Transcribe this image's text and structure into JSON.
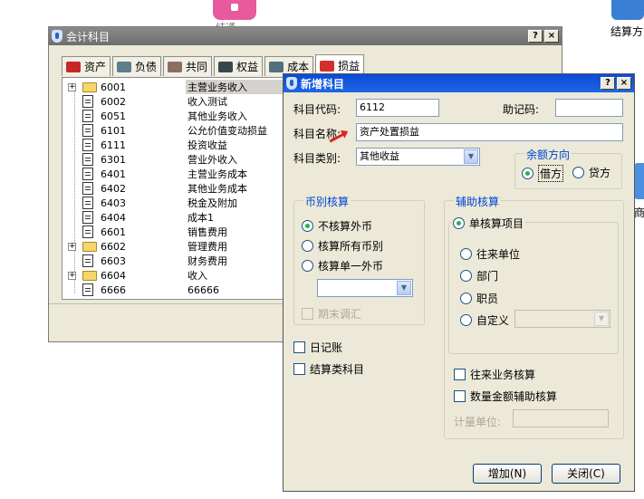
{
  "desktop": {
    "top_icon_label": "结通",
    "right_icon_label": "结算方式",
    "right_icon2_label": "商"
  },
  "accounts_window": {
    "title": "会计科目",
    "buttons": {
      "help": "?",
      "close": "×"
    },
    "tabs": [
      {
        "label": "资产",
        "icon": "car-icon",
        "color": "#c62828"
      },
      {
        "label": "负债",
        "icon": "card-icon",
        "color": "#607d8b"
      },
      {
        "label": "共同",
        "icon": "handshake-icon",
        "color": "#8d6e63"
      },
      {
        "label": "权益",
        "icon": "certificate-icon",
        "color": "#37474f"
      },
      {
        "label": "成本",
        "icon": "tools-icon",
        "color": "#546e7a"
      },
      {
        "label": "损益",
        "icon": "apple-icon",
        "color": "#d32f2f"
      }
    ],
    "active_tab": 5,
    "rows": [
      {
        "code": "6001",
        "name": "主营业务收入",
        "type": "folder",
        "expand": "+",
        "selected": true
      },
      {
        "code": "6002",
        "name": "收入测试",
        "type": "doc"
      },
      {
        "code": "6051",
        "name": "其他业务收入",
        "type": "doc"
      },
      {
        "code": "6101",
        "name": "公允价值变动损益",
        "type": "doc"
      },
      {
        "code": "6111",
        "name": "投资收益",
        "type": "doc"
      },
      {
        "code": "6301",
        "name": "营业外收入",
        "type": "doc"
      },
      {
        "code": "6401",
        "name": "主营业务成本",
        "type": "doc"
      },
      {
        "code": "6402",
        "name": "其他业务成本",
        "type": "doc"
      },
      {
        "code": "6403",
        "name": "税金及附加",
        "type": "doc"
      },
      {
        "code": "6404",
        "name": "成本1",
        "type": "doc"
      },
      {
        "code": "6601",
        "name": "销售费用",
        "type": "doc"
      },
      {
        "code": "6602",
        "name": "管理费用",
        "type": "folder",
        "expand": "+"
      },
      {
        "code": "6603",
        "name": "财务费用",
        "type": "doc"
      },
      {
        "code": "6604",
        "name": "收入",
        "type": "folder",
        "expand": "+"
      },
      {
        "code": "6666",
        "name": "66666",
        "type": "doc"
      }
    ]
  },
  "dialog": {
    "title": "新增科目",
    "buttons": {
      "help": "?",
      "close": "×"
    },
    "code_label": "科目代码:",
    "code_value": "6112",
    "mnemonic_label": "助记码:",
    "mnemonic_value": "",
    "name_label": "科目名称:",
    "name_value": "资产处置损益",
    "category_label": "科目类别:",
    "category_value": "其他收益",
    "balance": {
      "title": "余额方向",
      "debit": "借方",
      "credit": "贷方",
      "selected": "debit"
    },
    "currency": {
      "title": "币别核算",
      "opt_none": "不核算外币",
      "opt_all": "核算所有币别",
      "opt_single": "核算单一外币",
      "single_value": "",
      "period_end": "期末调汇"
    },
    "aux": {
      "title": "辅助核算",
      "single_item": "单核算项目",
      "contact": "往来单位",
      "department": "部门",
      "staff": "职员",
      "custom": "自定义",
      "custom_value": "",
      "contact_business": "往来业务核算",
      "qty_amount": "数量金额辅助核算",
      "unit_label": "计量单位:",
      "unit_value": ""
    },
    "journal": "日记账",
    "settlement": "结算类科目",
    "add_button": "增加(N)",
    "close_button": "关闭(C)"
  }
}
